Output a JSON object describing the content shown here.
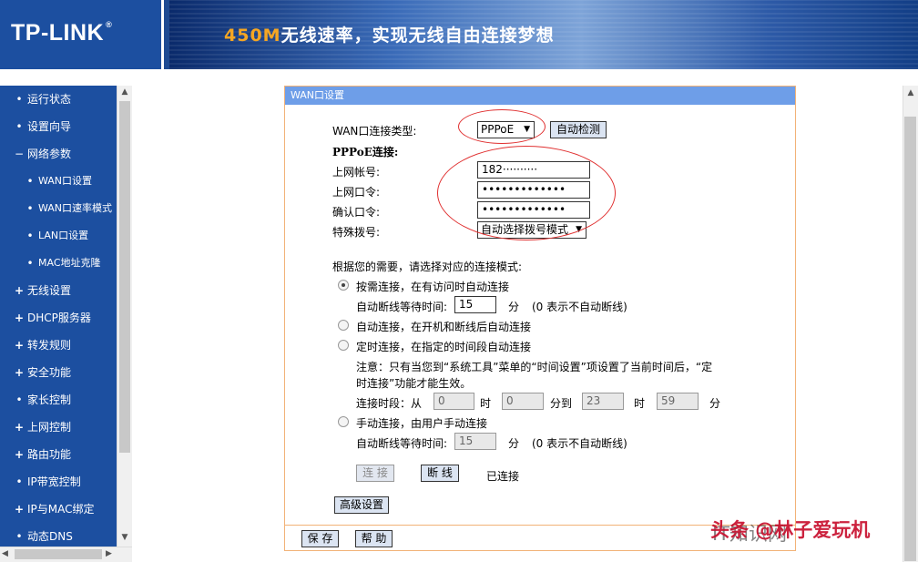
{
  "header": {
    "logo": "TP-LINK",
    "logo_reg": "®",
    "slogan_highlight": "450M",
    "slogan_rest": "无线速率，实现无线自由连接梦想"
  },
  "sidebar": {
    "items": [
      {
        "label": "运行状态",
        "bullet": "•",
        "sub": false
      },
      {
        "label": "设置向导",
        "bullet": "•",
        "sub": false
      },
      {
        "label": "网络参数",
        "bullet": "−",
        "sub": false
      },
      {
        "label": "WAN口设置",
        "bullet": "•",
        "sub": true
      },
      {
        "label": "WAN口速率模式",
        "bullet": "•",
        "sub": true
      },
      {
        "label": "LAN口设置",
        "bullet": "•",
        "sub": true
      },
      {
        "label": "MAC地址克隆",
        "bullet": "•",
        "sub": true
      },
      {
        "label": "无线设置",
        "bullet": "+",
        "sub": false
      },
      {
        "label": "DHCP服务器",
        "bullet": "+",
        "sub": false
      },
      {
        "label": "转发规则",
        "bullet": "+",
        "sub": false
      },
      {
        "label": "安全功能",
        "bullet": "+",
        "sub": false
      },
      {
        "label": "家长控制",
        "bullet": "•",
        "sub": false
      },
      {
        "label": "上网控制",
        "bullet": "+",
        "sub": false
      },
      {
        "label": "路由功能",
        "bullet": "+",
        "sub": false
      },
      {
        "label": "IP带宽控制",
        "bullet": "•",
        "sub": false
      },
      {
        "label": "IP与MAC绑定",
        "bullet": "+",
        "sub": false
      },
      {
        "label": "动态DNS",
        "bullet": "•",
        "sub": false
      }
    ]
  },
  "panel": {
    "title": "WAN口设置",
    "wan_type_label": "WAN口连接类型:",
    "wan_type_value": "PPPoE",
    "auto_detect_button": "自动检测",
    "pppoe_section": "PPPoE连接:",
    "account_label": "上网帐号:",
    "account_value": "182··········",
    "password_label": "上网口令:",
    "password_value": "•••••••••••••",
    "confirm_label": "确认口令:",
    "confirm_value": "•••••••••••••",
    "dial_label": "特殊拨号:",
    "dial_value": "自动选择拨号模式",
    "mode_prompt": "根据您的需要，请选择对应的连接模式:",
    "mode_on_demand": "按需连接，在有访问时自动连接",
    "idle_wait_label": "自动断线等待时间:",
    "idle_wait_value": "15",
    "idle_wait_unit": "分",
    "idle_wait_hint": "(0 表示不自动断线)",
    "mode_auto": "自动连接，在开机和断线后自动连接",
    "mode_timed": "定时连接，在指定的时间段自动连接",
    "timed_note_1": "注意：只有当您到“系统工具”菜单的“时间设置”项设置了当前时间后，“定",
    "timed_note_2": "时连接”功能才能生效。",
    "period_label": "连接时段：从",
    "period_from_h": "0",
    "hour_unit": "时",
    "period_from_m": "0",
    "minute_to": "分到",
    "period_to_h": "23",
    "period_to_m": "59",
    "minute_unit": "分",
    "mode_manual": "手动连接，由用户手动连接",
    "idle_wait2_label": "自动断线等待时间:",
    "idle_wait2_value": "15",
    "idle_wait2_unit": "分",
    "idle_wait2_hint": "(0 表示不自动断线)",
    "connect_button": "连 接",
    "disconnect_button": "断 线",
    "status": "已连接",
    "advanced_button": "高级设置",
    "save_button": "保 存",
    "help_button": "帮 助"
  },
  "watermark": "头条 @林子爱玩机",
  "watermark2": "IT知识网"
}
